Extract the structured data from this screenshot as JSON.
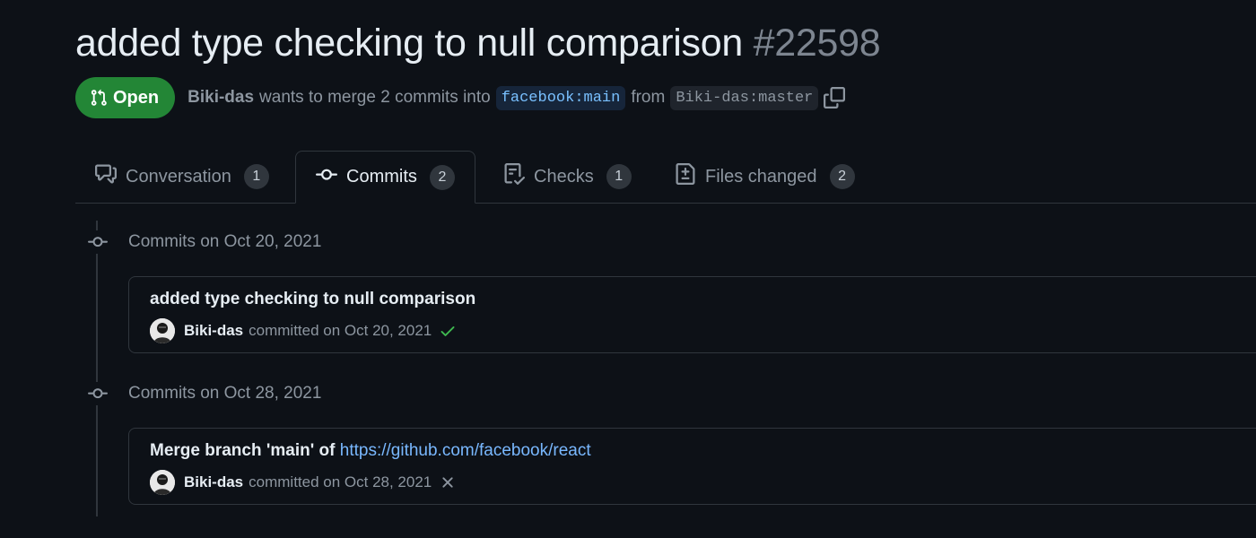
{
  "pr": {
    "title": "added type checking to null comparison",
    "number": "#22598",
    "state": "Open",
    "author": "Biki-das",
    "merge_text": "wants to merge 2 commits into",
    "base_branch": "facebook:main",
    "from_text": "from",
    "head_branch": "Biki-das:master"
  },
  "tabs": [
    {
      "label": "Conversation",
      "count": "1",
      "icon": "comment-discussion-icon",
      "active": false
    },
    {
      "label": "Commits",
      "count": "2",
      "icon": "git-commit-icon",
      "active": true
    },
    {
      "label": "Checks",
      "count": "1",
      "icon": "checklist-icon",
      "active": false
    },
    {
      "label": "Files changed",
      "count": "2",
      "icon": "file-diff-icon",
      "active": false
    }
  ],
  "commit_groups": [
    {
      "heading": "Commits on Oct 20, 2021",
      "commits": [
        {
          "title": "added type checking to null comparison",
          "link_text": "",
          "author": "Biki-das",
          "committed_text": "committed on Oct 20, 2021",
          "status": "success",
          "status_icon": "check-icon"
        }
      ]
    },
    {
      "heading": "Commits on Oct 28, 2021",
      "commits": [
        {
          "title": "Merge branch 'main' of",
          "link_text": "https://github.com/facebook/react",
          "author": "Biki-das",
          "committed_text": "committed on Oct 28, 2021",
          "status": "failure",
          "status_icon": "x-icon"
        }
      ]
    }
  ],
  "colors": {
    "background": "#0d1117",
    "open_badge": "#238636",
    "border": "#30363d",
    "link": "#79b8ff",
    "success": "#3fb950",
    "muted": "#8d96a0"
  }
}
